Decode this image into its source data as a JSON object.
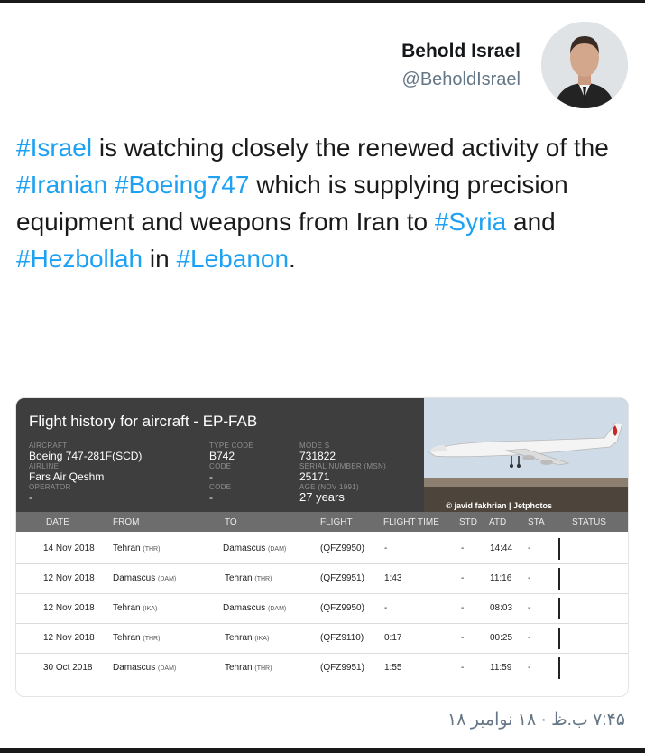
{
  "user": {
    "name": "Behold Israel",
    "handle": "@BeholdIsrael"
  },
  "tweet": {
    "segments": [
      {
        "text": "#Israel",
        "tag": true
      },
      {
        "text": " is watching closely the renewed activity of the ",
        "tag": false
      },
      {
        "text": "#Iranian",
        "tag": true
      },
      {
        "text": " ",
        "tag": false
      },
      {
        "text": "#Boeing747",
        "tag": true
      },
      {
        "text": " which is supplying precision equipment and weapons from Iran to ",
        "tag": false
      },
      {
        "text": "#Syria",
        "tag": true
      },
      {
        "text": " and ",
        "tag": false
      },
      {
        "text": "#Hezbollah",
        "tag": true
      },
      {
        "text": " in ",
        "tag": false
      },
      {
        "text": "#Lebanon",
        "tag": true
      },
      {
        "text": ".",
        "tag": false
      }
    ]
  },
  "card": {
    "title": "Flight history for aircraft - EP-FAB",
    "aircraft_label": "AIRCRAFT",
    "aircraft": "Boeing 747-281F(SCD)",
    "airline_label": "AIRLINE",
    "airline": "Fars Air Qeshm",
    "operator_label": "OPERATOR",
    "operator": "-",
    "type_code_label": "TYPE CODE",
    "type_code": "B742",
    "code_label": "Code",
    "code": "-",
    "code2_label": "Code",
    "code2": "-",
    "mode_s_label": "MODE S",
    "mode_s": "731822",
    "serial_label": "SERIAL NUMBER (MSN)",
    "serial": "25171",
    "age_label": "AGE (Nov 1991)",
    "age": "27 years",
    "photo_credit": "© javid fakhrian | Jetphotos",
    "columns": [
      "DATE",
      "FROM",
      "TO",
      "FLIGHT",
      "FLIGHT TIME",
      "STD",
      "ATD",
      "STA",
      "STATUS"
    ],
    "rows": [
      {
        "date": "14 Nov 2018",
        "from": "Tehran",
        "from_code": "(THR)",
        "to": "Damascus",
        "to_code": "(DAM)",
        "flight": "(QFZ9950)",
        "time": "-",
        "std": "-",
        "atd": "14:44",
        "sta": "-"
      },
      {
        "date": "12 Nov 2018",
        "from": "Damascus",
        "from_code": "(DAM)",
        "to": "Tehran",
        "to_code": "(THR)",
        "flight": "(QFZ9951)",
        "time": "1:43",
        "std": "-",
        "atd": "11:16",
        "sta": "-"
      },
      {
        "date": "12 Nov 2018",
        "from": "Tehran",
        "from_code": "(IKA)",
        "to": "Damascus",
        "to_code": "(DAM)",
        "flight": "(QFZ9950)",
        "time": "-",
        "std": "-",
        "atd": "08:03",
        "sta": "-"
      },
      {
        "date": "12 Nov 2018",
        "from": "Tehran",
        "from_code": "(THR)",
        "to": "Tehran",
        "to_code": "(IKA)",
        "flight": "(QFZ9110)",
        "time": "0:17",
        "std": "-",
        "atd": "00:25",
        "sta": "-"
      },
      {
        "date": "30 Oct 2018",
        "from": "Damascus",
        "from_code": "(DAM)",
        "to": "Tehran",
        "to_code": "(THR)",
        "flight": "(QFZ9951)",
        "time": "1:55",
        "std": "-",
        "atd": "11:59",
        "sta": "-"
      }
    ]
  },
  "timestamp": "۷:۴۵ ب.ظ · ۱۸ نوامبر ۱۸",
  "colors": {
    "hashtag": "#1da1f2",
    "secondary_text": "#657786",
    "card_header_bg": "#3e3e3e",
    "table_header_bg": "#6d6d6d"
  }
}
